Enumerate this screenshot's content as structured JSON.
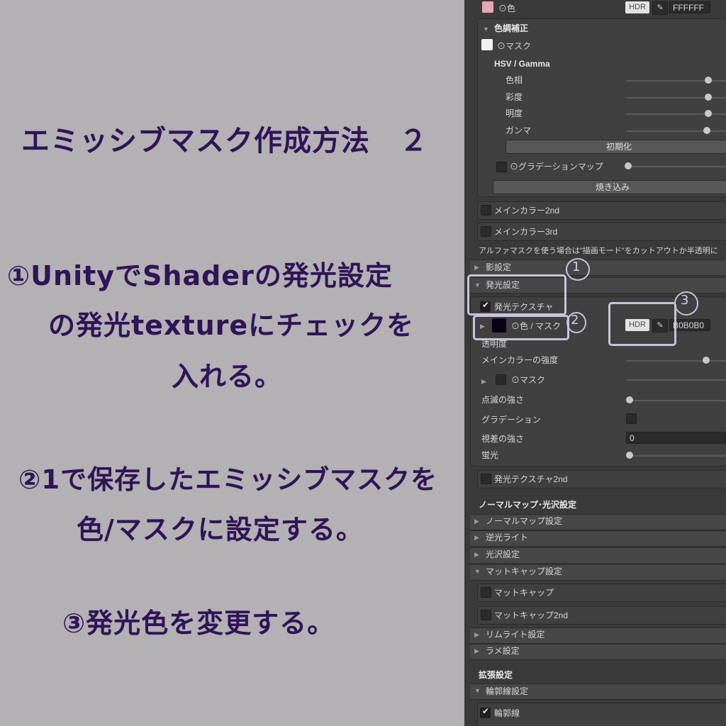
{
  "left": {
    "title": "エミッシブマスク作成方法　２",
    "step1_lines": [
      "①UnityでShaderの発光設定",
      "の発光textureにチェックを",
      "入れる。"
    ],
    "step2_lines": [
      "②1で保存したエミッシブマスクを",
      "色/マスクに設定する。"
    ],
    "step3_lines": [
      "③発光色を変更する。"
    ],
    "text_color": "#2f1457"
  },
  "panel": {
    "color_row": {
      "label": "⊙色",
      "hdr": "HDR",
      "picker_icon": "eyedropper-icon",
      "value": "FFFFFF"
    },
    "tone": {
      "title": "色調補正",
      "mask_label": "⊙マスク",
      "hsv_title": "HSV / Gamma",
      "sliders": [
        {
          "label": "色相",
          "level": 0.9
        },
        {
          "label": "彩度",
          "level": 0.9
        },
        {
          "label": "明度",
          "level": 0.9
        },
        {
          "label": "ガンマ",
          "level": 0.9
        }
      ],
      "reset_button": "初期化",
      "gradation_map": "⊙グラデーションマップ",
      "bake_button": "焼き込み"
    },
    "main2": "メインカラー2nd",
    "main3": "メインカラー3rd",
    "alpha_note": "アルファマスクを使う場合は\"描画モード\"をカットアウトか半透明に",
    "shadow": "影設定",
    "emission": {
      "title": "発光設定",
      "texture_label": "発光テクスチャ",
      "texture_checked": true,
      "color_mask_label": "⊙色 / マスク",
      "hdr": "HDR",
      "value": "B0B0B0",
      "transparency": "透明度",
      "main_strength": "メインカラーの強度",
      "mask": "⊙マスク",
      "blink": "点滅の強さ",
      "gradation": "グラデーション",
      "parallax": "視差の強さ",
      "parallax_value": "0",
      "fluorescent": "蛍光",
      "texture2": "発光テクスチャ2nd"
    },
    "normal_section": {
      "title": "ノーマルマップ･光沢設定",
      "items": [
        "ノーマルマップ設定",
        "逆光ライト",
        "光沢設定"
      ],
      "matcap_title": "マットキャップ設定",
      "matcap": "マットキャップ",
      "matcap2": "マットキャップ2nd",
      "rim": "リムライト設定",
      "glitter": "ラメ設定"
    },
    "extended": {
      "title": "拡張設定",
      "outline_settings": "輪郭線設定",
      "outline": "輪郭線",
      "outline_checked": true
    },
    "annotations": {
      "n1": "1",
      "n2": "2",
      "n3": "3"
    }
  }
}
